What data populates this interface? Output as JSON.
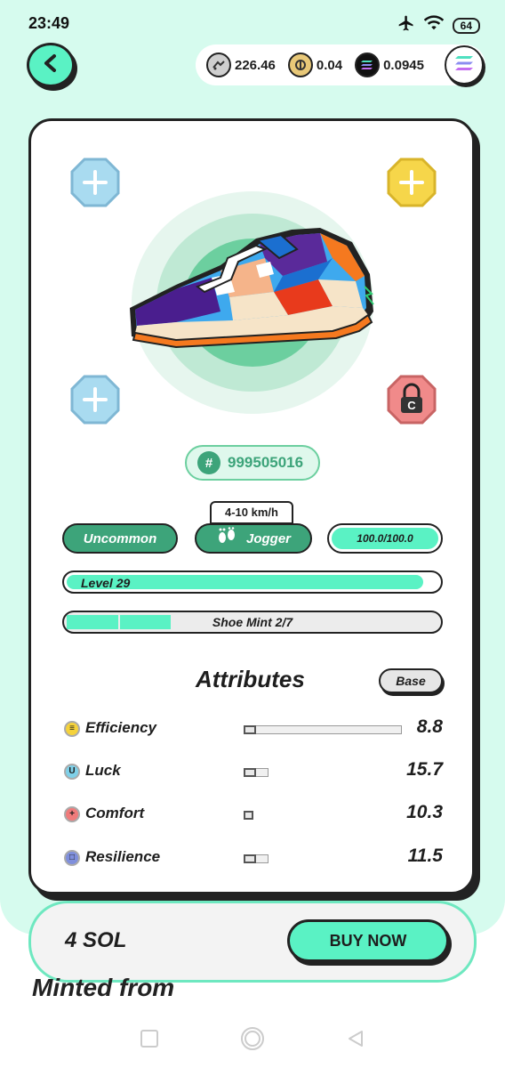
{
  "status_bar": {
    "time": "23:49",
    "battery": "64"
  },
  "wallet": {
    "balances": [
      {
        "icon": "gst-coin-icon",
        "value": "226.46"
      },
      {
        "icon": "gmt-coin-icon",
        "value": "0.04"
      },
      {
        "icon": "sol-coin-icon",
        "value": "0.0945"
      }
    ]
  },
  "sneaker": {
    "id_hash": "#",
    "id": "999505016",
    "speed_range": "4-10 km/h",
    "rarity": "Uncommon",
    "type": "Jogger",
    "durability": "100.0/100.0",
    "durability_fraction": 1.0,
    "level_label": "Level 29",
    "level_fraction": 0.96,
    "shoe_mint": "Shoe Mint 2/7",
    "mint_count": 2,
    "mint_total": 7,
    "lock_letter": "C"
  },
  "attributes": {
    "title": "Attributes",
    "base_label": "Base",
    "items": [
      {
        "name": "Efficiency",
        "value": "8.8",
        "color": "#f5d23b",
        "symbol": "≡",
        "base_fraction": 0.08,
        "max_fraction": 1.0
      },
      {
        "name": "Luck",
        "value": "15.7",
        "color": "#7fd0e8",
        "symbol": "U",
        "base_fraction": 0.08,
        "max_fraction": 0.16
      },
      {
        "name": "Comfort",
        "value": "10.3",
        "color": "#f07b7b",
        "symbol": "+",
        "base_fraction": 0.06,
        "max_fraction": 0.06
      },
      {
        "name": "Resilience",
        "value": "11.5",
        "color": "#7f8fdc",
        "symbol": "□",
        "base_fraction": 0.08,
        "max_fraction": 0.16
      }
    ]
  },
  "purchase": {
    "price": "4 SOL",
    "button": "BUY NOW"
  },
  "section_heading": "Minted from",
  "colors": {
    "mint": "#5af2c4",
    "green": "#3da47a",
    "background": "#d6fbee"
  }
}
